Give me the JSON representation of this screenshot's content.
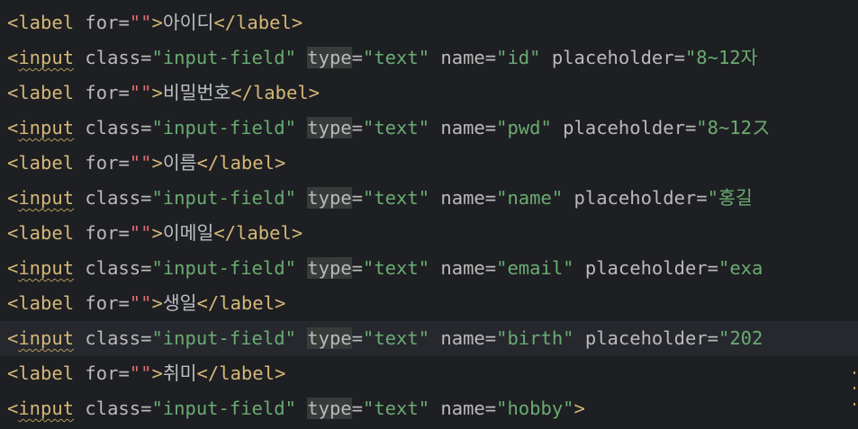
{
  "editor": {
    "lines": [
      {
        "kind": "label",
        "for_value": "",
        "text": "아이디"
      },
      {
        "kind": "input",
        "class_value": "input-field",
        "type_value": "text",
        "name_value": "id",
        "placeholder_value": "8~12자"
      },
      {
        "kind": "label",
        "for_value": "",
        "text": "비밀번호"
      },
      {
        "kind": "input",
        "class_value": "input-field",
        "type_value": "text",
        "name_value": "pwd",
        "placeholder_value": "8~12ス"
      },
      {
        "kind": "label",
        "for_value": "",
        "text": "이름"
      },
      {
        "kind": "input",
        "class_value": "input-field",
        "type_value": "text",
        "name_value": "name",
        "placeholder_value": "홍길"
      },
      {
        "kind": "label",
        "for_value": "",
        "text": "이메일"
      },
      {
        "kind": "input",
        "class_value": "input-field",
        "type_value": "text",
        "name_value": "email",
        "placeholder_value": "exa"
      },
      {
        "kind": "label",
        "for_value": "",
        "text": "생일"
      },
      {
        "kind": "input",
        "class_value": "input-field",
        "type_value": "text",
        "name_value": "birth",
        "placeholder_value": "202"
      },
      {
        "kind": "label",
        "for_value": "",
        "text": "취미"
      },
      {
        "kind": "input",
        "class_value": "input-field",
        "type_value": "text",
        "name_value": "hobby",
        "close": ">"
      }
    ],
    "current_line_index": 9
  },
  "syntax": {
    "tag_open": "<",
    "tag_close": ">",
    "end_tag_open": "</",
    "label_tag": "label",
    "input_tag": "input",
    "attr_for": "for",
    "attr_class": "class",
    "attr_type": "type",
    "attr_name": "name",
    "attr_placeholder": "placeholder",
    "equals": "=",
    "quote": "\""
  },
  "colors": {
    "background": "#1e1f22",
    "current_line": "#26282e",
    "tag": "#d5b778",
    "attribute": "#bababa",
    "string": "#6aab73",
    "empty_string_quote": "#e06c75",
    "text": "#bcbec4",
    "type_highlight": "#373b39"
  }
}
